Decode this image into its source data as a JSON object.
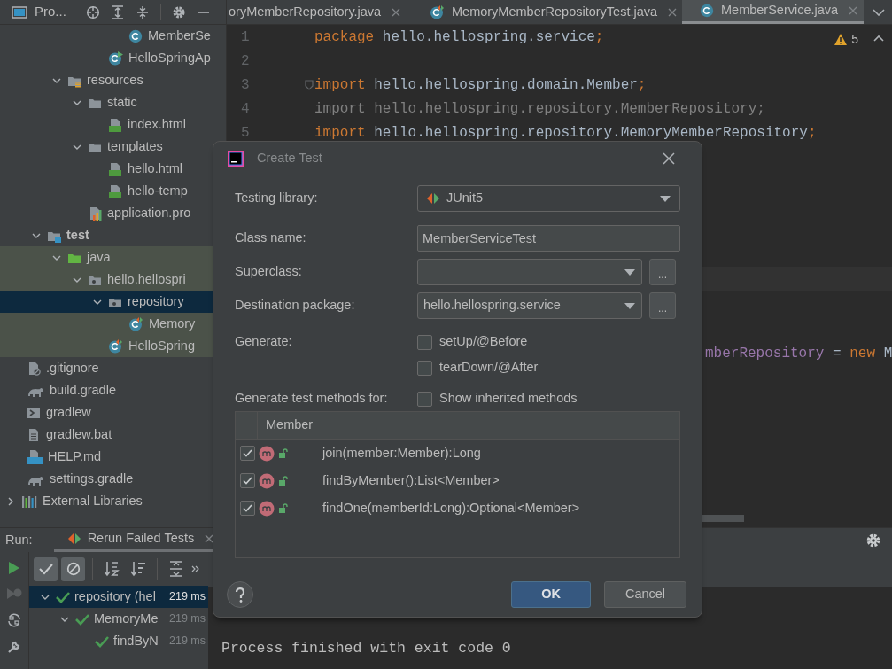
{
  "project_panel": {
    "title": "Pro...",
    "tree": [
      {
        "children": [
          {
            "children": [
              {
                "children": [
                  {
                    "children": [
                      {
                        "children": [
                          {
                            "children": [
                              {
                                "label": "MemberSe",
                                "kind": "class",
                                "selected": false,
                                "highlighted": false
                              }
                            ]
                          },
                          {
                            "label": "HelloSpringAp",
                            "kind": "app-class",
                            "selected": false,
                            "highlighted": false
                          }
                        ]
                      }
                    ]
                  },
                  {
                    "label": "resources",
                    "kind": "resources-folder",
                    "expanded": true,
                    "selected": false,
                    "highlighted": false,
                    "children": [
                      {
                        "label": "static",
                        "kind": "folder",
                        "expanded": true,
                        "selected": false,
                        "highlighted": false,
                        "children": [
                          {
                            "label": "index.html",
                            "kind": "html",
                            "selected": false,
                            "highlighted": false
                          }
                        ]
                      },
                      {
                        "label": "templates",
                        "kind": "folder",
                        "expanded": true,
                        "selected": false,
                        "highlighted": false,
                        "children": [
                          {
                            "label": "hello.html",
                            "kind": "html",
                            "selected": false,
                            "highlighted": false
                          },
                          {
                            "label": "hello-temp",
                            "kind": "html",
                            "selected": false,
                            "highlighted": false
                          }
                        ]
                      },
                      {
                        "label": "application.pro",
                        "kind": "properties",
                        "selected": false,
                        "highlighted": false
                      }
                    ]
                  }
                ]
              },
              {
                "label": "test",
                "kind": "test-root",
                "expanded": true,
                "bold": true,
                "selected": false,
                "highlighted": false,
                "children": [
                  {
                    "label": "java",
                    "kind": "test-folder",
                    "expanded": true,
                    "selected": false,
                    "highlighted": true,
                    "children": [
                      {
                        "label": "hello.hellospri",
                        "kind": "package",
                        "expanded": true,
                        "selected": false,
                        "highlighted": true,
                        "children": [
                          {
                            "label": "repository",
                            "kind": "package",
                            "expanded": true,
                            "selected": true,
                            "children": [
                              {
                                "label": "Memory",
                                "kind": "test-class",
                                "selected": false,
                                "highlighted": true
                              }
                            ]
                          },
                          {
                            "label": "HelloSpring",
                            "kind": "test-class",
                            "selected": false,
                            "highlighted": true
                          }
                        ]
                      }
                    ]
                  }
                ]
              }
            ]
          },
          {
            "label": ".gitignore",
            "kind": "ignore",
            "selected": false,
            "highlighted": false
          },
          {
            "label": "build.gradle",
            "kind": "gradle",
            "selected": false,
            "highlighted": false
          },
          {
            "label": "gradlew",
            "kind": "shell",
            "selected": false,
            "highlighted": false
          },
          {
            "label": "gradlew.bat",
            "kind": "text",
            "selected": false,
            "highlighted": false
          },
          {
            "label": "HELP.md",
            "kind": "md",
            "selected": false,
            "highlighted": false
          },
          {
            "label": "settings.gradle",
            "kind": "gradle",
            "selected": false,
            "highlighted": false
          }
        ]
      },
      {
        "label": "External Libraries",
        "kind": "libraries",
        "expanded": false,
        "selected": false,
        "highlighted": false
      }
    ]
  },
  "editor": {
    "tabs": [
      {
        "label": "oryMemberRepository.java",
        "selected": false
      },
      {
        "label": "MemoryMemberRepositoryTest.java",
        "kind": "test-class",
        "selected": false
      },
      {
        "label": "MemberService.java",
        "kind": "class",
        "selected": true
      }
    ],
    "warnings": "5",
    "lines": [
      {
        "number": "1",
        "fold": false,
        "tokens": [
          {
            "kind": "keyword",
            "text": "package"
          },
          {
            "kind": "plain",
            "text": " hello.hellospring.service"
          },
          {
            "kind": "keyword",
            "text": ";"
          }
        ]
      },
      {
        "number": "2",
        "fold": false
      },
      {
        "number": "3",
        "fold": true,
        "tokens": [
          {
            "kind": "keyword",
            "text": "import"
          },
          {
            "kind": "plain",
            "text": " hello.hellospring.domain.Member"
          },
          {
            "kind": "keyword",
            "text": ";"
          }
        ]
      },
      {
        "number": "4",
        "fold": false,
        "tokens": [
          {
            "kind": "unused",
            "text": "import hello.hellospring.repository.MemberRepository;"
          }
        ]
      },
      {
        "number": "5",
        "fold": false,
        "tokens": [
          {
            "kind": "keyword",
            "text": "import"
          },
          {
            "kind": "plain",
            "text": " hello.hellospring.repository.MemoryMemberRepository"
          },
          {
            "kind": "keyword",
            "text": ";"
          }
        ]
      }
    ],
    "partial_line": [
      {
        "kind": "field",
        "text": "mberRepository"
      },
      {
        "kind": "plain",
        "text": " = "
      },
      {
        "kind": "keyword",
        "text": "new"
      },
      {
        "kind": "plain",
        "text": " M"
      }
    ]
  },
  "dialog": {
    "title": "Create Test",
    "testing_library": {
      "label": "Testing library:",
      "value": "JUnit5"
    },
    "class_name": {
      "label": "Class name:",
      "value": "MemberServiceTest"
    },
    "superclass": {
      "label": "Superclass:"
    },
    "destination_package": {
      "label": "Destination package:",
      "value": "hello.hellospring.service"
    },
    "browse_button": "...",
    "generate": {
      "label": "Generate:",
      "options": [
        {
          "label": "setUp/@Before",
          "checked": false
        },
        {
          "label": "tearDown/@After",
          "checked": false
        }
      ]
    },
    "methods_for": {
      "label": "Generate test methods for:",
      "show_inherited": {
        "label": "Show inherited methods",
        "checked": false
      }
    },
    "methods_table": {
      "column": "Member",
      "rows": [
        {
          "signature": "join(member:Member):Long",
          "checked": true
        },
        {
          "signature": "findByMember():List<Member>",
          "checked": true
        },
        {
          "signature": "findOne(memberId:Long):Optional<Member>",
          "checked": true
        }
      ]
    },
    "buttons": [
      "OK",
      "Cancel"
    ]
  },
  "run_panel": {
    "label": "Run:",
    "tab": "Rerun Failed Tests",
    "filters": [
      {
        "kind": "passed",
        "pressed": true
      },
      {
        "kind": "ignored",
        "pressed": true
      }
    ],
    "tests": [
      {
        "label": "repository (hel",
        "duration": "219 ms",
        "selected": true,
        "expanded": true,
        "children": [
          {
            "label": "MemoryMe",
            "duration": "219 ms",
            "selected": false,
            "expanded": true,
            "children": [
              {
                "label": "findByN",
                "duration": "219 ms",
                "selected": false
              }
            ]
          }
        ]
      }
    ],
    "console": "Process finished with exit code 0"
  }
}
